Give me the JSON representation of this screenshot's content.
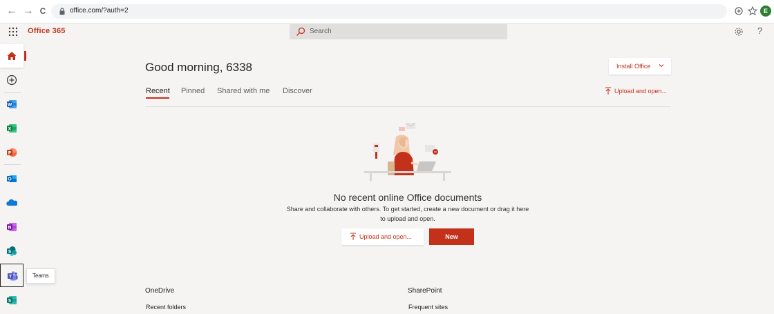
{
  "browser": {
    "url": "office.com/?auth=2",
    "back_glyph": "←",
    "forward_glyph": "→",
    "reload_glyph": "C",
    "profile_initial": "E"
  },
  "header": {
    "brand": "Office 365",
    "search_placeholder": "Search",
    "help_glyph": "?"
  },
  "rail": {
    "items": [
      "home",
      "create",
      "word",
      "excel",
      "powerpoint",
      "outlook",
      "onedrive",
      "onenote",
      "sharepoint",
      "teams",
      "sway"
    ],
    "tooltip": "Teams"
  },
  "main": {
    "greeting": "Good morning, 6338",
    "install_label": "Install Office",
    "tabs": [
      {
        "label": "Recent",
        "selected": true
      },
      {
        "label": "Pinned",
        "selected": false
      },
      {
        "label": "Shared with me",
        "selected": false
      },
      {
        "label": "Discover",
        "selected": false
      }
    ],
    "upload_open_label": "Upload and open...",
    "empty_title": "No recent online Office documents",
    "empty_desc_line1": "Share and collaborate with others. To get started, create a new document or drag it here",
    "empty_desc_line2": "to upload and open.",
    "upload_button_label": "Upload and open...",
    "new_button_label": "New"
  },
  "sections": {
    "onedrive": {
      "title": "OneDrive",
      "sub": "Recent folders"
    },
    "sharepoint": {
      "title": "SharePoint",
      "sub": "Frequent sites"
    }
  },
  "colors": {
    "accent": "#c4311b",
    "background": "#f5f4f3"
  }
}
